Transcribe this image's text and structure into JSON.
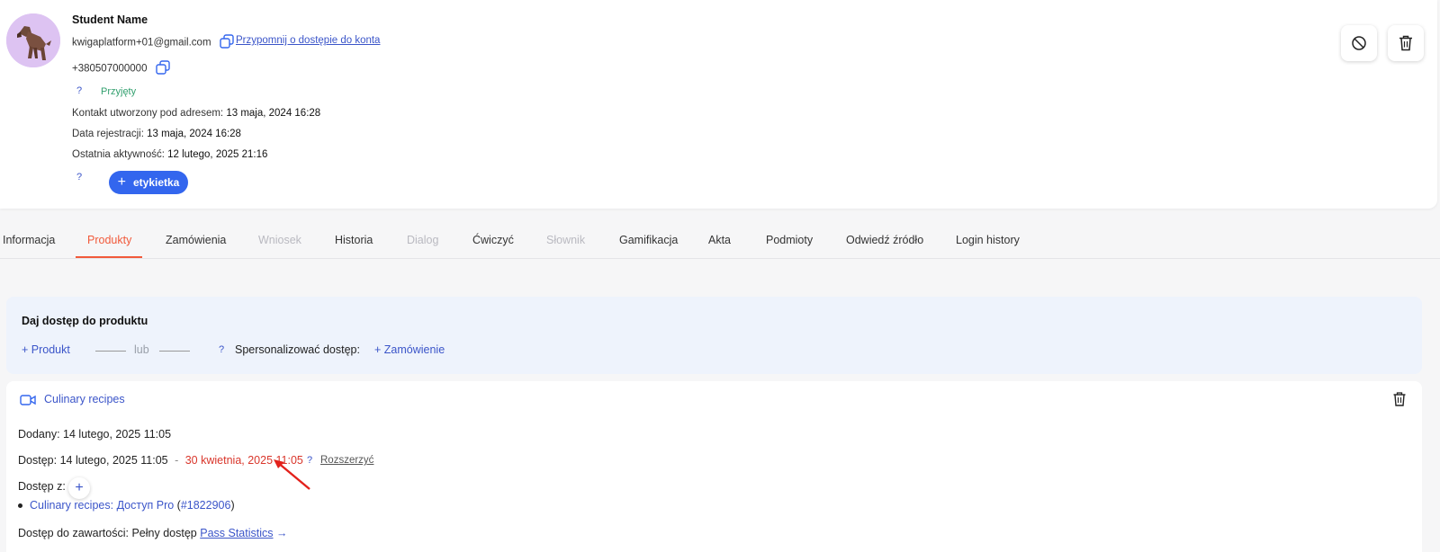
{
  "profile": {
    "name": "Student Name",
    "email": "kwigaplatform+01@gmail.com",
    "remind_link": "Przypomnij o dostępie do konta",
    "phone": "+380507000000",
    "help_mark": "?",
    "status": "Przyjęty",
    "created_label": "Kontakt utworzony pod adresem:",
    "created_value": "13 maja, 2024 16:28",
    "reg_label": "Data rejestracji:",
    "reg_value": "13 maja, 2024 16:28",
    "last_label": "Ostatnia aktywność:",
    "last_value": "12 lutego, 2025 21:16",
    "tag_button": "etykietka",
    "tag_plus": "+"
  },
  "tabs": [
    {
      "label": "Informacja"
    },
    {
      "label": "Produkty"
    },
    {
      "label": "Zamówienia"
    },
    {
      "label": "Wniosek"
    },
    {
      "label": "Historia"
    },
    {
      "label": "Dialog"
    },
    {
      "label": "Ćwiczyć"
    },
    {
      "label": "Słownik"
    },
    {
      "label": "Gamifikacja"
    },
    {
      "label": "Akta"
    },
    {
      "label": "Podmioty"
    },
    {
      "label": "Odwiedź źródło"
    },
    {
      "label": "Login history"
    }
  ],
  "access_box": {
    "title": "Daj dostęp do produktu",
    "add_product": "+ Produkt",
    "or": "lub",
    "personalize": "Spersonalizować dostęp:",
    "add_order": "+ Zamówienie"
  },
  "product": {
    "title": "Culinary recipes",
    "added_label": "Dodany:",
    "added_value": "14 lutego, 2025 11:05",
    "access_label": "Dostęp:",
    "access_start": "14 lutego, 2025 11:05",
    "access_dash": "-",
    "access_end": "30 kwietnia, 2025 11:05",
    "extend": "Rozszerzyć",
    "from_label": "Dostęp z:",
    "plus": "+",
    "source_name": "Culinary recipes: Доступ Pro",
    "source_id": "#1822906",
    "content_label": "Dostęp do zawartości:",
    "content_value": "Pełny dostęp",
    "pass_stats": "Pass Statistics",
    "arrow": "→"
  },
  "colors": {
    "accent": "#3366ee",
    "link": "#3b55c9",
    "active_tab": "#f15a3b",
    "status_green": "#33a06f",
    "expiry_red": "#d9362b",
    "avatar_bg": "#ddc3f2"
  }
}
